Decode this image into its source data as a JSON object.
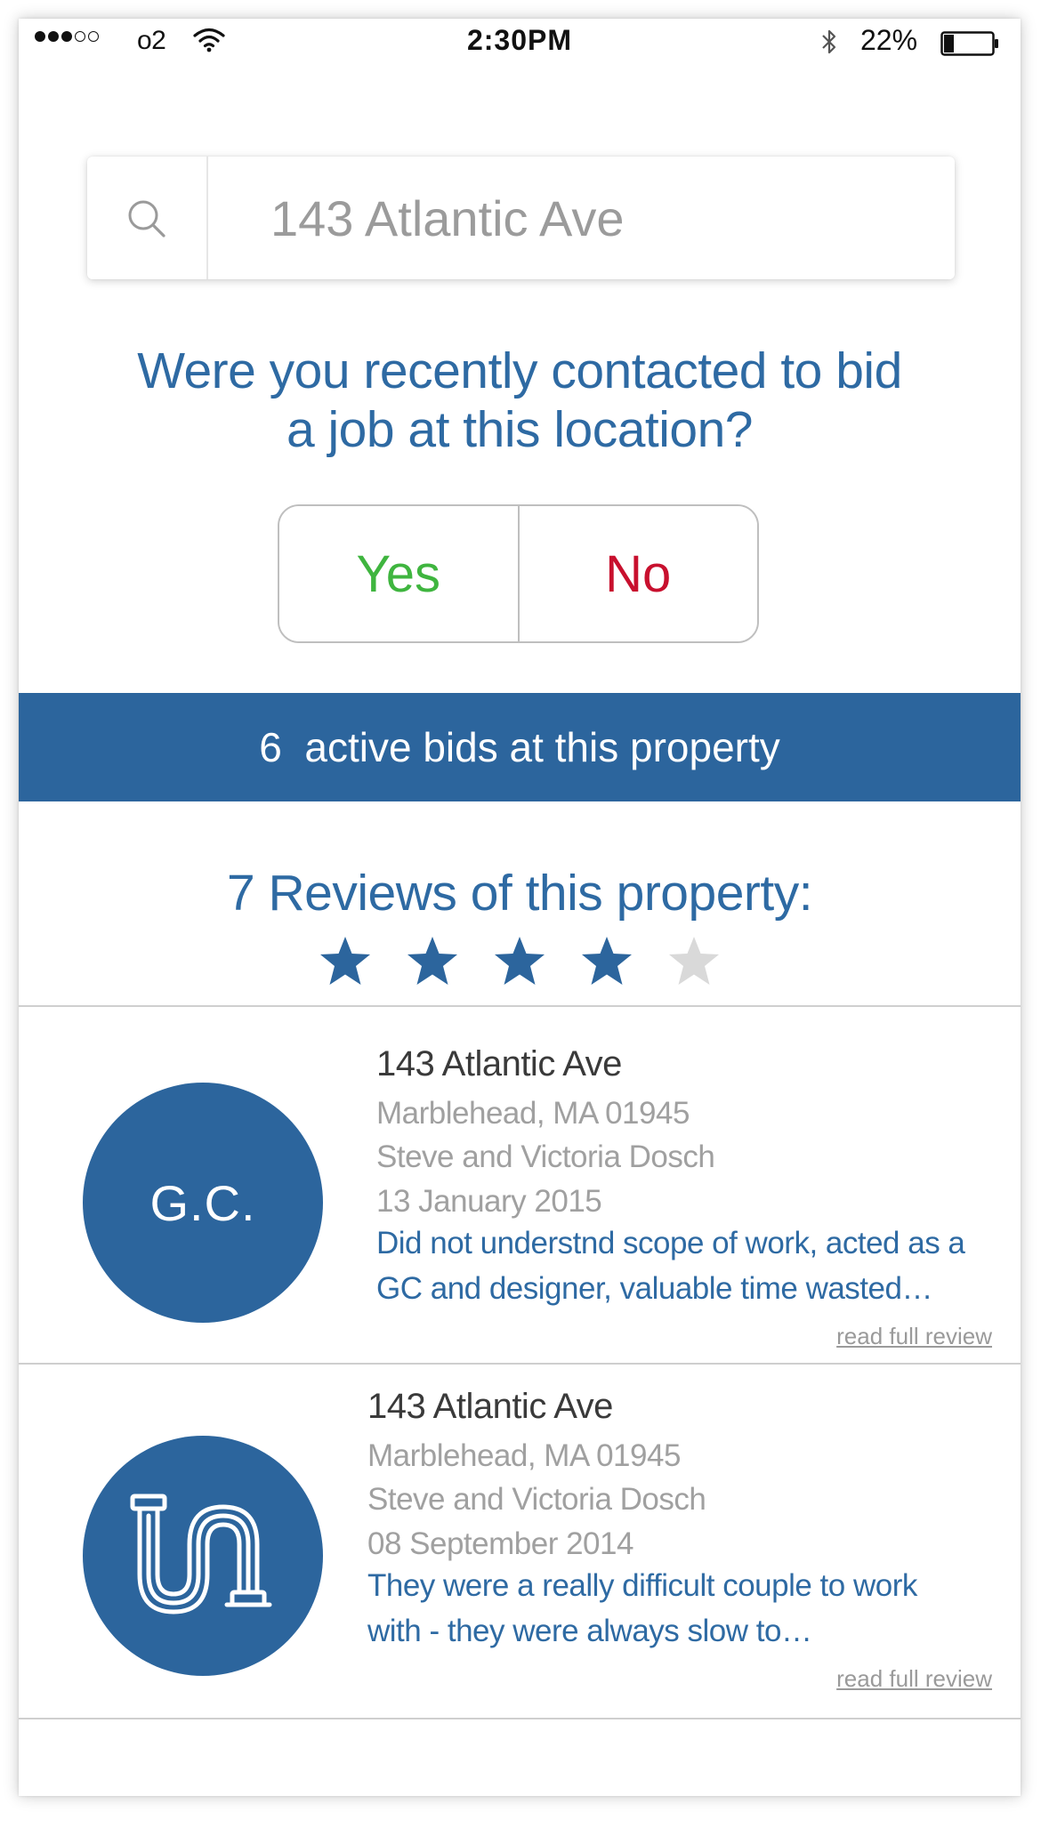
{
  "status_bar": {
    "carrier": "o2",
    "time": "2:30PM",
    "battery_percent": "22%",
    "battery_level": 0.22,
    "signal_strength": 3,
    "signal_max": 5
  },
  "search": {
    "value": "143 Atlantic Ave",
    "icon": "search-icon"
  },
  "question": {
    "line1": "Were you recently contacted to bid",
    "line2": "a job at this location?"
  },
  "answer": {
    "yes_label": "Yes",
    "no_label": "No"
  },
  "bids": {
    "count": "6",
    "text": "active bids at this property"
  },
  "reviews_header": {
    "title": "7 Reviews of this property:",
    "rating": 4,
    "max_rating": 5
  },
  "colors": {
    "brand_blue": "#2c659d",
    "text_blue": "#2e6aa3",
    "yes_green": "#3fb53f",
    "no_red": "#c8102e",
    "star_inactive": "#d9d9d9"
  },
  "reviews": [
    {
      "avatar_text": "G.C.",
      "address": "143 Atlantic Ave",
      "city": "Marblehead, MA 01945",
      "owners": "Steve and Victoria Dosch",
      "date": "13 January 2015",
      "text_line1": "Did not understnd scope of work, acted as a",
      "text_line2": "GC and designer, valuable time wasted…",
      "link": "read full review"
    },
    {
      "avatar_icon": "pipe-icon",
      "address": "143 Atlantic Ave",
      "city": "Marblehead, MA 01945",
      "owners": "Steve and Victoria Dosch",
      "date": "08 September 2014",
      "text_line1": "They were a really difficult couple to work",
      "text_line2": "with - they were always slow to…",
      "link": "read full review"
    }
  ]
}
